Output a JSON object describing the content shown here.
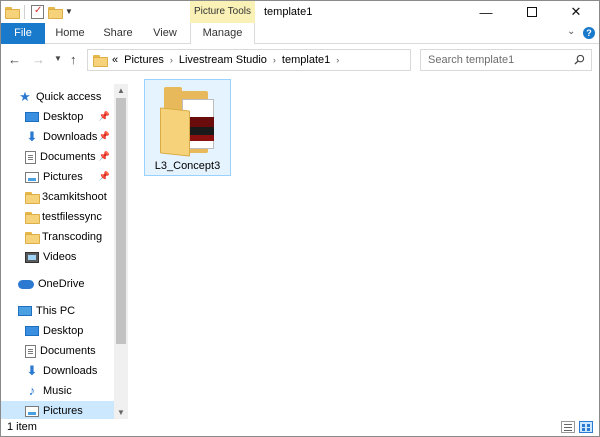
{
  "window": {
    "title": "template1",
    "contextual_group": "Picture Tools"
  },
  "ribbon": {
    "tabs": [
      {
        "label": "File"
      },
      {
        "label": "Home"
      },
      {
        "label": "Share"
      },
      {
        "label": "View"
      },
      {
        "label": "Manage"
      }
    ]
  },
  "address": {
    "prefix": "«",
    "crumbs": [
      "Pictures",
      "Livestream Studio",
      "template1"
    ]
  },
  "search": {
    "placeholder": "Search template1"
  },
  "sidebar": {
    "items": [
      {
        "label": "Quick access",
        "icon": "star-icon"
      },
      {
        "label": "Desktop",
        "icon": "desktop-icon",
        "pinned": true
      },
      {
        "label": "Downloads",
        "icon": "download-icon",
        "pinned": true
      },
      {
        "label": "Documents",
        "icon": "documents-icon",
        "pinned": true
      },
      {
        "label": "Pictures",
        "icon": "pictures-icon",
        "pinned": true
      },
      {
        "label": "3camkitshoot",
        "icon": "folder-icon"
      },
      {
        "label": "testfilessync",
        "icon": "folder-icon"
      },
      {
        "label": "Transcoding",
        "icon": "folder-icon"
      },
      {
        "label": "Videos",
        "icon": "videos-icon"
      },
      {
        "label": "OneDrive",
        "icon": "cloud-icon"
      },
      {
        "label": "This PC",
        "icon": "pc-icon"
      },
      {
        "label": "Desktop",
        "icon": "desktop-icon"
      },
      {
        "label": "Documents",
        "icon": "documents-icon"
      },
      {
        "label": "Downloads",
        "icon": "download-icon"
      },
      {
        "label": "Music",
        "icon": "music-icon"
      },
      {
        "label": "Pictures",
        "icon": "pictures-icon",
        "selected": true
      }
    ]
  },
  "content": {
    "files": [
      {
        "name": "L3_Concept3",
        "type": "folder",
        "selected": true
      }
    ]
  },
  "status": {
    "item_count": "1 item"
  },
  "colors": {
    "accent": "#1979ca",
    "selection": "#cce8ff",
    "contextual_tab": "#faf1b6"
  }
}
